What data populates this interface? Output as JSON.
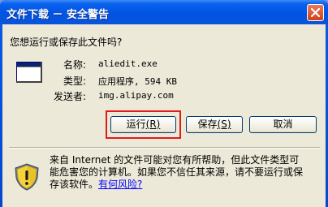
{
  "window": {
    "title": "文件下载 － 安全警告",
    "close_label": "×"
  },
  "dialog": {
    "question": "您想运行或保存此文件吗?",
    "file": {
      "name_label": "名称:",
      "name_value": "aliedit.exe",
      "type_label": "类型:",
      "type_value": "应用程序, 594 KB",
      "publisher_label": "发送者:",
      "publisher_value": "img.alipay.com"
    },
    "buttons": {
      "run_text": "运行",
      "run_key": "(R)",
      "save_text": "保存",
      "save_key": "(S)",
      "cancel": "取消"
    },
    "warning": {
      "line1": "来自 Internet 的文件可能对您有所帮助，但此文件类型可",
      "line2": "能危害您的计算机。如果您不信任其来源，请不要运行或保",
      "line3_prefix": "存该软件。",
      "link": "有何风险?"
    }
  },
  "colors": {
    "titlebar": "#0054e3",
    "dialog_bg": "#ece9d8",
    "highlight_box": "#e31a1c",
    "link": "#0000ff"
  },
  "icons": {
    "file": "application-window-icon",
    "warning": "security-shield-icon",
    "close": "close-icon"
  }
}
